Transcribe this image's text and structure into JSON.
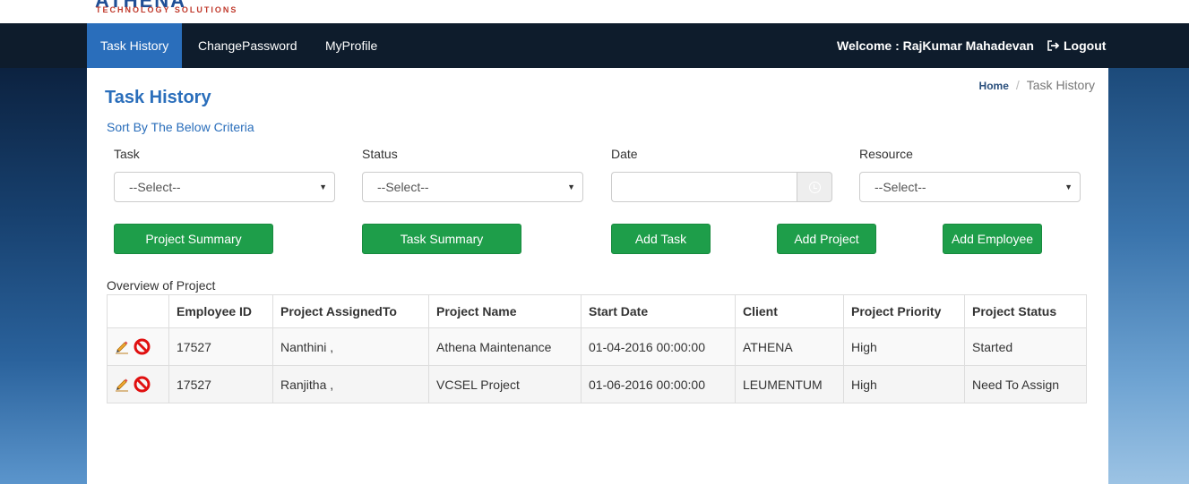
{
  "logo": {
    "main": "ATHENA",
    "sub": "TECHNOLOGY SOLUTIONS"
  },
  "nav": {
    "items": [
      {
        "label": "Task History",
        "active": true
      },
      {
        "label": "ChangePassword",
        "active": false
      },
      {
        "label": "MyProfile",
        "active": false
      }
    ],
    "welcome": "Welcome : RajKumar Mahadevan",
    "logout": "Logout",
    "logout_icon": "sign-out-icon"
  },
  "page": {
    "title": "Task History",
    "breadcrumb": {
      "home": "Home",
      "current": "Task History"
    },
    "sort_label": "Sort By The Below Criteria"
  },
  "filters": {
    "task": {
      "label": "Task",
      "value": "--Select--"
    },
    "status": {
      "label": "Status",
      "value": "--Select--"
    },
    "date": {
      "label": "Date",
      "value": "",
      "icon": "clock-icon"
    },
    "resource": {
      "label": "Resource",
      "value": "--Select--"
    }
  },
  "buttons": {
    "project_summary": "Project Summary",
    "task_summary": "Task Summary",
    "add_task": "Add Task",
    "add_project": "Add Project",
    "add_employee": "Add Employee"
  },
  "table": {
    "caption": "Overview of Project",
    "headers": [
      "",
      "Employee ID",
      "Project AssignedTo",
      "Project Name",
      "Start Date",
      "Client",
      "Project Priority",
      "Project Status"
    ],
    "rows": [
      {
        "employee_id": "17527",
        "assigned_to": "Nanthini ,",
        "project_name": "Athena Maintenance",
        "start_date": "01-04-2016 00:00:00",
        "client": "ATHENA",
        "priority": "High",
        "status": "Started"
      },
      {
        "employee_id": "17527",
        "assigned_to": "Ranjitha ,",
        "project_name": "VCSEL Project",
        "start_date": "01-06-2016 00:00:00",
        "client": "LEUMENTUM",
        "priority": "High",
        "status": "Need To Assign"
      }
    ],
    "row_icons": [
      "edit-pencil-icon",
      "delete-no-icon"
    ]
  },
  "colors": {
    "nav_bg": "#0e1c2c",
    "nav_active": "#2a6ebb",
    "title": "#2a6ebb",
    "button": "#1e9e4a"
  }
}
